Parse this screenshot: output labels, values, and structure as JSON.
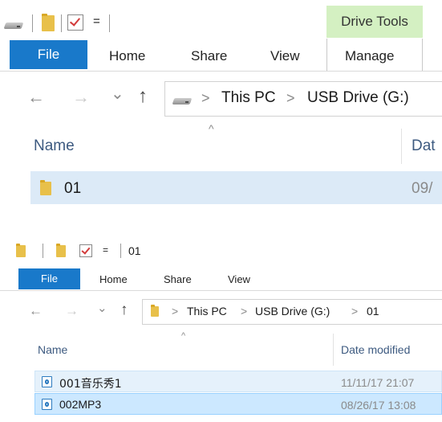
{
  "top": {
    "contextual_tab": "Drive Tools",
    "tabs": {
      "file": "File",
      "home": "Home",
      "share": "Share",
      "view": "View",
      "manage": "Manage"
    },
    "qat_dropdown": "=",
    "breadcrumb": {
      "sep": ">",
      "this_pc": "This PC",
      "usb": "USB Drive (G:)"
    },
    "columns": {
      "name": "Name",
      "date": "Dat"
    },
    "rows": [
      {
        "name": "01",
        "date": "09/"
      }
    ]
  },
  "bottom": {
    "title": "01",
    "qat_dropdown": "=",
    "tabs": {
      "file": "File",
      "home": "Home",
      "share": "Share",
      "view": "View"
    },
    "breadcrumb": {
      "sep": ">",
      "this_pc": "This PC",
      "usb": "USB Drive (G:)",
      "folder": "01"
    },
    "columns": {
      "name": "Name",
      "date": "Date modified"
    },
    "rows": [
      {
        "name": "001音乐秀1",
        "date": "11/11/17 21:07"
      },
      {
        "name": "002MP3",
        "date": "08/26/17 13:08"
      }
    ]
  },
  "glyphs": {
    "back": "←",
    "forward": "→",
    "recent": "⌄",
    "up": "↑",
    "sort": "^"
  },
  "colors": {
    "accent": "#1979ca",
    "contextual": "#d4f0c2",
    "selection": "#dceaf7"
  }
}
